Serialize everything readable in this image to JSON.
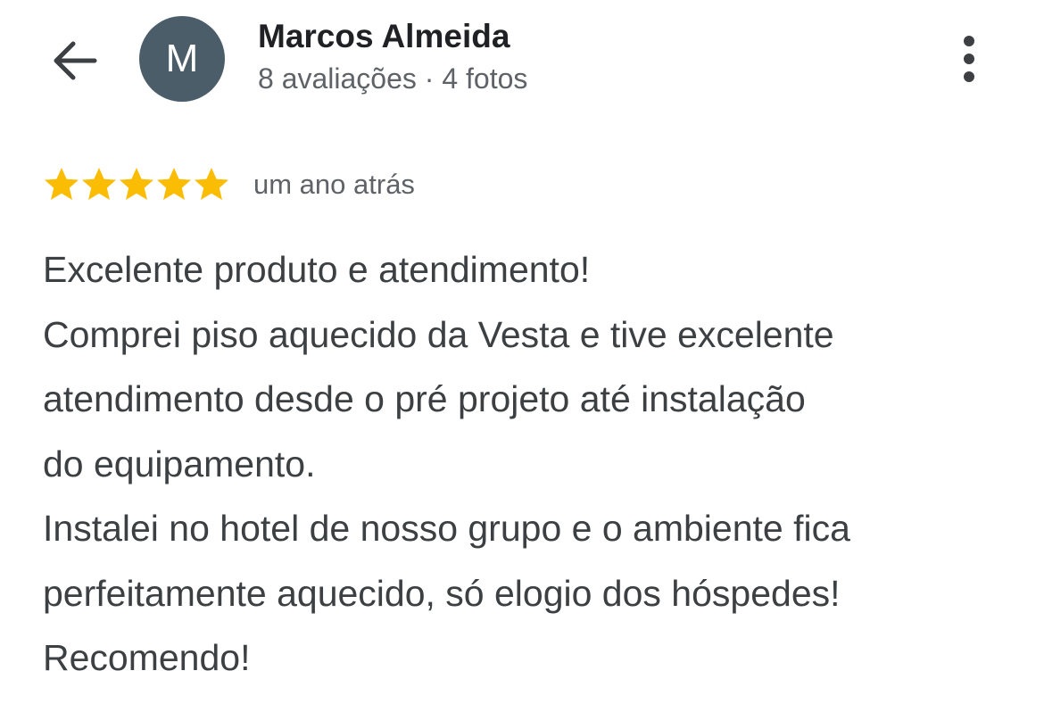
{
  "header": {
    "back_icon": "arrow-back-icon",
    "avatar_letter": "M",
    "avatar_color": "#4a5d68",
    "user_name": "Marcos Almeida",
    "user_meta": "8 avaliações · 4 fotos",
    "more_icon": "more-vert-icon"
  },
  "review": {
    "rating": 5,
    "rating_max": 5,
    "star_color": "#fbbc04",
    "date": "um ano atrás",
    "lines": [
      "Excelente produto e atendimento!",
      "Comprei piso aquecido da Vesta e tive excelente",
      "atendimento desde o pré projeto até instalação",
      "do equipamento.",
      "Instalei no hotel de nosso grupo e o ambiente fica",
      "perfeitamente aquecido, só elogio dos hóspedes!",
      "Recomendo!"
    ]
  }
}
